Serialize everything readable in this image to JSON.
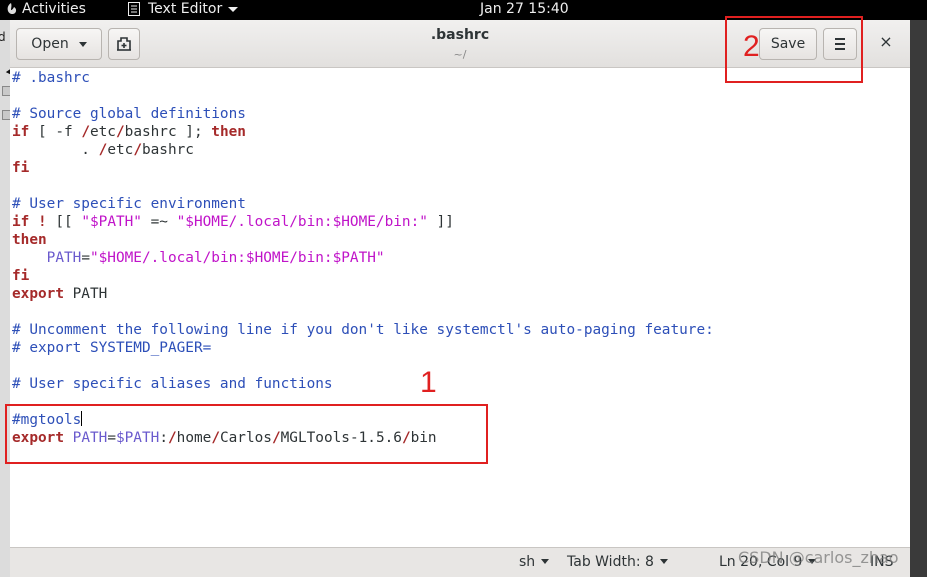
{
  "topbar": {
    "activities": "Activities",
    "app_name": "Text Editor",
    "clock": "Jan 27  15:40"
  },
  "desktop_left": {
    "letter": "d"
  },
  "window": {
    "title": ".bashrc",
    "subtitle": "~/",
    "open_label": "Open",
    "save_label": "Save",
    "close_label": "×"
  },
  "editor": {
    "lines": [
      [
        {
          "t": "# .bashrc",
          "c": "cm"
        }
      ],
      [],
      [
        {
          "t": "# Source global definitions",
          "c": "cm"
        }
      ],
      [
        {
          "t": "if",
          "c": "kw"
        },
        {
          "t": " [ -f "
        },
        {
          "t": "/",
          "c": "kw"
        },
        {
          "t": "etc"
        },
        {
          "t": "/",
          "c": "kw"
        },
        {
          "t": "bashrc ]; "
        },
        {
          "t": "then",
          "c": "kw"
        }
      ],
      [
        {
          "t": "        . "
        },
        {
          "t": "/",
          "c": "kw"
        },
        {
          "t": "etc"
        },
        {
          "t": "/",
          "c": "kw"
        },
        {
          "t": "bashrc"
        }
      ],
      [
        {
          "t": "fi",
          "c": "kw"
        }
      ],
      [],
      [
        {
          "t": "# User specific environment",
          "c": "cm"
        }
      ],
      [
        {
          "t": "if",
          "c": "kw"
        },
        {
          "t": " "
        },
        {
          "t": "!",
          "c": "kw"
        },
        {
          "t": " [[ "
        },
        {
          "t": "\"$PATH\"",
          "c": "str"
        },
        {
          "t": " =~ "
        },
        {
          "t": "\"$HOME/.local/bin:$HOME/bin:\"",
          "c": "str"
        },
        {
          "t": " ]]"
        }
      ],
      [
        {
          "t": "then",
          "c": "kw"
        }
      ],
      [
        {
          "t": "    PATH",
          "c": "var"
        },
        {
          "t": "="
        },
        {
          "t": "\"$HOME/.local/bin:$HOME/bin:$PATH\"",
          "c": "str"
        }
      ],
      [
        {
          "t": "fi",
          "c": "kw"
        }
      ],
      [
        {
          "t": "export",
          "c": "kw"
        },
        {
          "t": " PATH"
        }
      ],
      [],
      [
        {
          "t": "# Uncomment the following line if you don't like systemctl's auto-paging feature:",
          "c": "cm"
        }
      ],
      [
        {
          "t": "# export SYSTEMD_PAGER=",
          "c": "cm"
        }
      ],
      [],
      [
        {
          "t": "# User specific aliases and functions",
          "c": "cm"
        }
      ],
      [],
      [
        {
          "t": "#mgtools",
          "c": "cm"
        },
        {
          "t": "",
          "cursor": true
        }
      ],
      [
        {
          "t": "export",
          "c": "kw"
        },
        {
          "t": " "
        },
        {
          "t": "PATH",
          "c": "var"
        },
        {
          "t": "="
        },
        {
          "t": "$PATH",
          "c": "var"
        },
        {
          "t": ":"
        },
        {
          "t": "/",
          "c": "kw"
        },
        {
          "t": "home"
        },
        {
          "t": "/",
          "c": "kw"
        },
        {
          "t": "Carlos"
        },
        {
          "t": "/",
          "c": "kw"
        },
        {
          "t": "MGLTools-1.5.6"
        },
        {
          "t": "/",
          "c": "kw"
        },
        {
          "t": "bin"
        }
      ]
    ]
  },
  "statusbar": {
    "language": "sh",
    "tab_width": "Tab Width: 8",
    "position": "Ln 20, Col 9",
    "mode": "INS"
  },
  "annotations": {
    "label_1": "1",
    "label_2": "2",
    "watermark": "CSDN @carlos_zhao"
  }
}
